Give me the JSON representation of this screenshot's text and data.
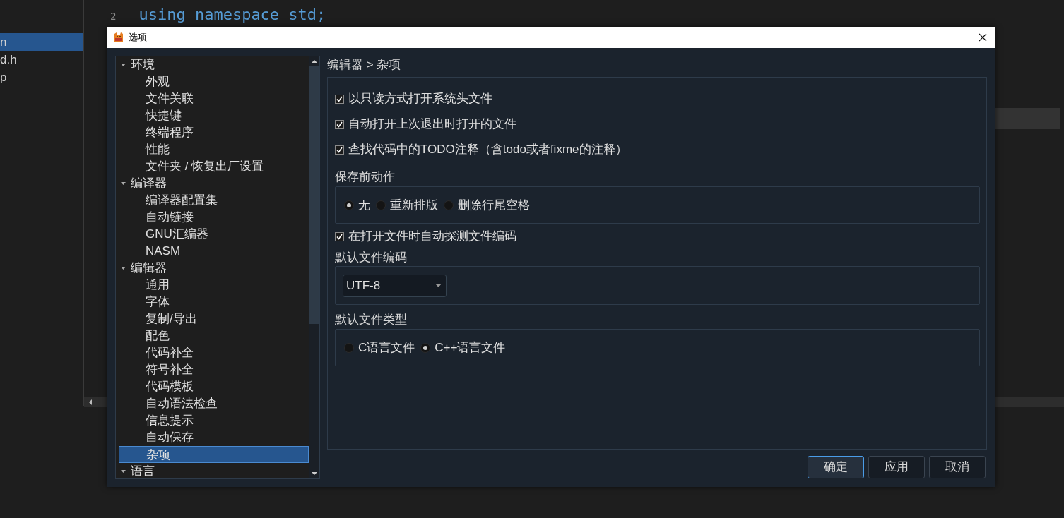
{
  "background": {
    "file_list": [
      {
        "name": "n",
        "selected": true
      },
      {
        "name": "d.h",
        "selected": false
      },
      {
        "name": "p",
        "selected": false
      }
    ],
    "code_lines": [
      {
        "number": "2",
        "text": "using namespace std;"
      }
    ]
  },
  "dialog": {
    "title": "选项",
    "tree": [
      {
        "label": "环境",
        "expanded": true,
        "children": [
          {
            "label": "外观",
            "selected": false
          },
          {
            "label": "文件关联",
            "selected": false
          },
          {
            "label": "快捷键",
            "selected": false
          },
          {
            "label": "终端程序",
            "selected": false
          },
          {
            "label": "性能",
            "selected": false
          },
          {
            "label": "文件夹 / 恢复出厂设置",
            "selected": false
          }
        ]
      },
      {
        "label": "编译器",
        "expanded": true,
        "children": [
          {
            "label": "编译器配置集",
            "selected": false
          },
          {
            "label": "自动链接",
            "selected": false
          },
          {
            "label": "GNU汇编器",
            "selected": false
          },
          {
            "label": "NASM",
            "selected": false
          }
        ]
      },
      {
        "label": "编辑器",
        "expanded": true,
        "children": [
          {
            "label": "通用",
            "selected": false
          },
          {
            "label": "字体",
            "selected": false
          },
          {
            "label": "复制/导出",
            "selected": false
          },
          {
            "label": "配色",
            "selected": false
          },
          {
            "label": "代码补全",
            "selected": false
          },
          {
            "label": "符号补全",
            "selected": false
          },
          {
            "label": "代码模板",
            "selected": false
          },
          {
            "label": "自动语法检查",
            "selected": false
          },
          {
            "label": "信息提示",
            "selected": false
          },
          {
            "label": "自动保存",
            "selected": false
          },
          {
            "label": "杂项",
            "selected": true
          }
        ]
      },
      {
        "label": "语言",
        "expanded": true
      }
    ],
    "breadcrumb": "编辑器 > 杂项",
    "options": [
      {
        "kind": "checkbox",
        "label": "以只读方式打开系统头文件",
        "checked": true
      },
      {
        "kind": "checkbox",
        "label": "自动打开上次退出时打开的文件",
        "checked": true
      },
      {
        "kind": "checkbox",
        "label": "查找代码中的TODO注释（含todo或者fixme的注释）",
        "checked": true
      },
      {
        "kind": "radio_group",
        "title": "保存前动作",
        "options": [
          {
            "label": "无",
            "selected": true
          },
          {
            "label": "重新排版",
            "selected": false
          },
          {
            "label": "删除行尾空格",
            "selected": false
          }
        ]
      },
      {
        "kind": "checkbox",
        "label": "在打开文件时自动探测文件编码",
        "checked": true
      },
      {
        "kind": "select_group",
        "title": "默认文件编码",
        "value": "UTF-8"
      },
      {
        "kind": "radio_group",
        "title": "默认文件类型",
        "options": [
          {
            "label": "C语言文件",
            "selected": false
          },
          {
            "label": "C++语言文件",
            "selected": true
          }
        ]
      }
    ],
    "buttons": [
      {
        "label": "确定",
        "default": true
      },
      {
        "label": "应用",
        "default": false
      },
      {
        "label": "取消",
        "default": false
      }
    ]
  }
}
